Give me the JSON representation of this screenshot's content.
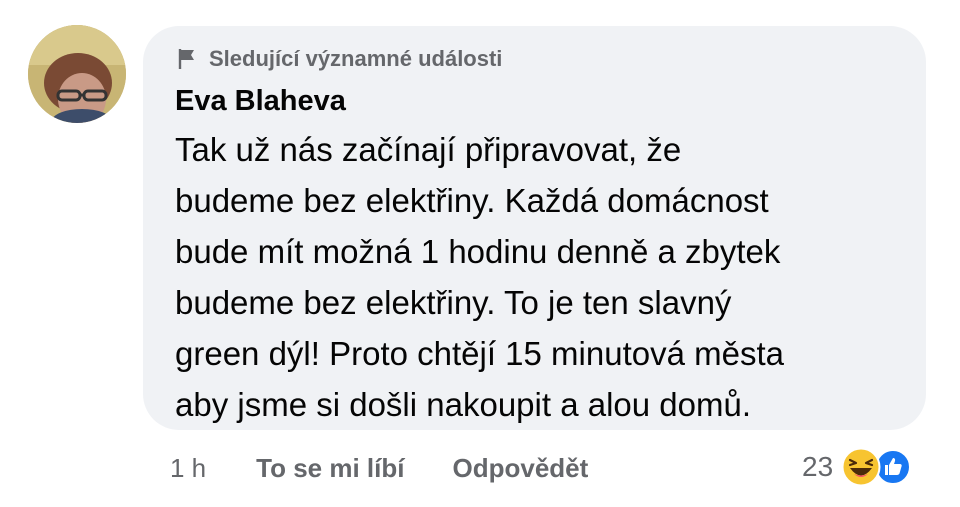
{
  "comment": {
    "badge": "Sledující významné události",
    "author": "Eva Blaheva",
    "text": "Tak už nás začínají připravovat, že\nbudeme bez elektřiny. Každá domácnost\nbude mít možná 1 hodinu denně a zbytek\nbudeme bez elektřiny. To je ten slavný\ngreen dýl! Proto chtějí 15 minutová města\naby jsme si došli nakoupit a alou domů.",
    "time": "1 h",
    "like_label": "To se mi líbí",
    "reply_label": "Odpovědět",
    "reaction_count": "23",
    "reaction_icons": [
      "haha-emoji-icon",
      "like-thumb-icon"
    ]
  },
  "colors": {
    "bubble_bg": "#f0f2f5",
    "secondary_text": "#65676b",
    "primary_text": "#050505",
    "like_blue": "#1877f2",
    "haha_yellow": "#f7c430"
  }
}
